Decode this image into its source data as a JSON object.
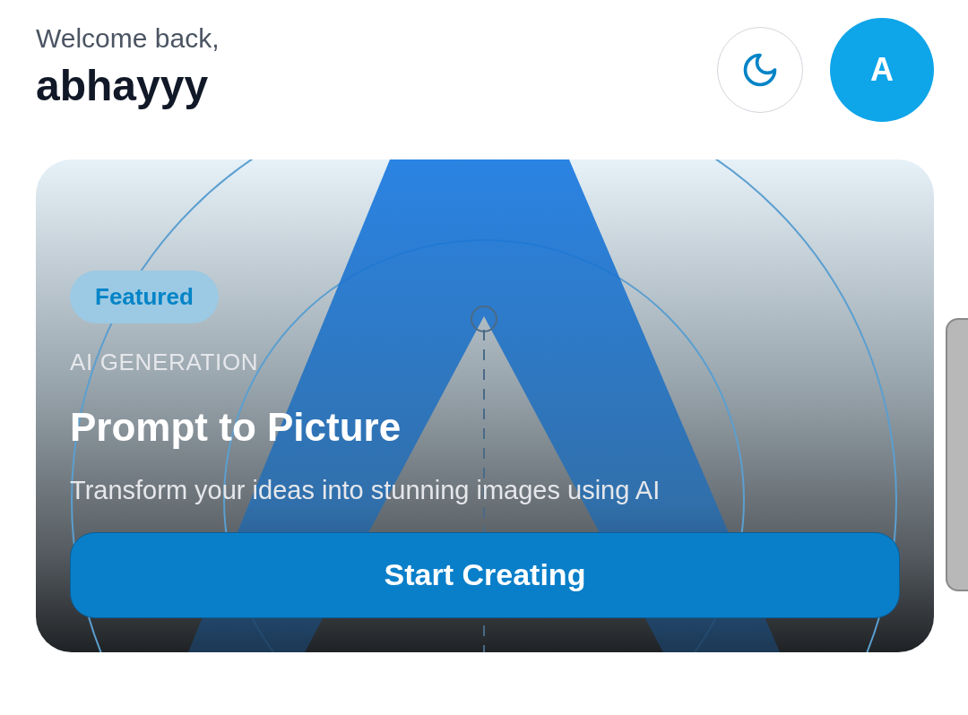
{
  "header": {
    "greeting": "Welcome back,",
    "username": "abhayyy",
    "avatar_initial": "A"
  },
  "featured_card": {
    "badge": "Featured",
    "category": "AI GENERATION",
    "title": "Prompt to Picture",
    "description": "Transform your ideas into stunning images using AI",
    "button": "Start Creating"
  }
}
